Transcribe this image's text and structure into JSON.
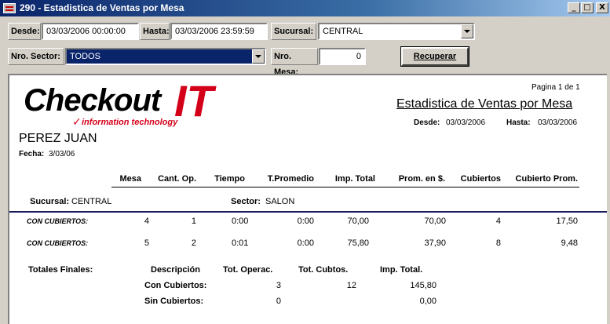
{
  "window": {
    "title": "290 - Estadistica de Ventas por Mesa",
    "buttons": {
      "minimize": "_",
      "maximize": "□",
      "close": "X"
    }
  },
  "filters": {
    "desde_label": "Desde:",
    "desde_value": "03/03/2006 00:00:00",
    "hasta_label": "Hasta:",
    "hasta_value": "03/03/2006 23:59:59",
    "sucursal_label": "Sucursal:",
    "sucursal_value": "CENTRAL",
    "sector_label": "Nro. Sector:",
    "sector_value": "TODOS",
    "mesa_label": "Nro. Mesa:",
    "mesa_value": "0",
    "recuperar_label": "Recuperar"
  },
  "report": {
    "page_info": "Pagina 1 de 1",
    "logo_main": "Checkout",
    "logo_it": "IT",
    "logo_sub": "information technology",
    "title": "Estadistica de Ventas por Mesa",
    "desde_label": "Desde:",
    "desde_value": "03/03/2006",
    "hasta_label": "Hasta:",
    "hasta_value": "03/03/2006",
    "user_name": "PEREZ JUAN",
    "fecha_label": "Fecha:",
    "fecha_value": "3/03/06",
    "columns": [
      "Mesa",
      "Cant. Op.",
      "Tiempo",
      "T.Promedio",
      "Imp. Total",
      "Prom. en $.",
      "Cubiertos",
      "Cubierto Prom."
    ],
    "sucursal_label": "Sucursal:",
    "sucursal_value": "CENTRAL",
    "sector_label": "Sector:",
    "sector_value": "SALON",
    "rows": [
      {
        "label": "CON CUBIERTOS:",
        "cells": [
          "4",
          "1",
          "0:00",
          "0:00",
          "70,00",
          "70,00",
          "4",
          "17,50"
        ]
      },
      {
        "label": "CON CUBIERTOS:",
        "cells": [
          "5",
          "2",
          "0:01",
          "0:00",
          "75,80",
          "37,90",
          "8",
          "9,48"
        ]
      }
    ],
    "totals": {
      "label": "Totales Finales:",
      "headers": [
        "Descripción",
        "Tot. Operac.",
        "Tot. Cubtos.",
        "Imp. Total."
      ],
      "rows": [
        {
          "desc": "Con Cubiertos:",
          "ops": "3",
          "cubtos": "12",
          "imp": "145,80"
        },
        {
          "desc": "Sin Cubiertos:",
          "ops": "0",
          "cubtos": "",
          "imp": "0,00"
        }
      ]
    }
  }
}
